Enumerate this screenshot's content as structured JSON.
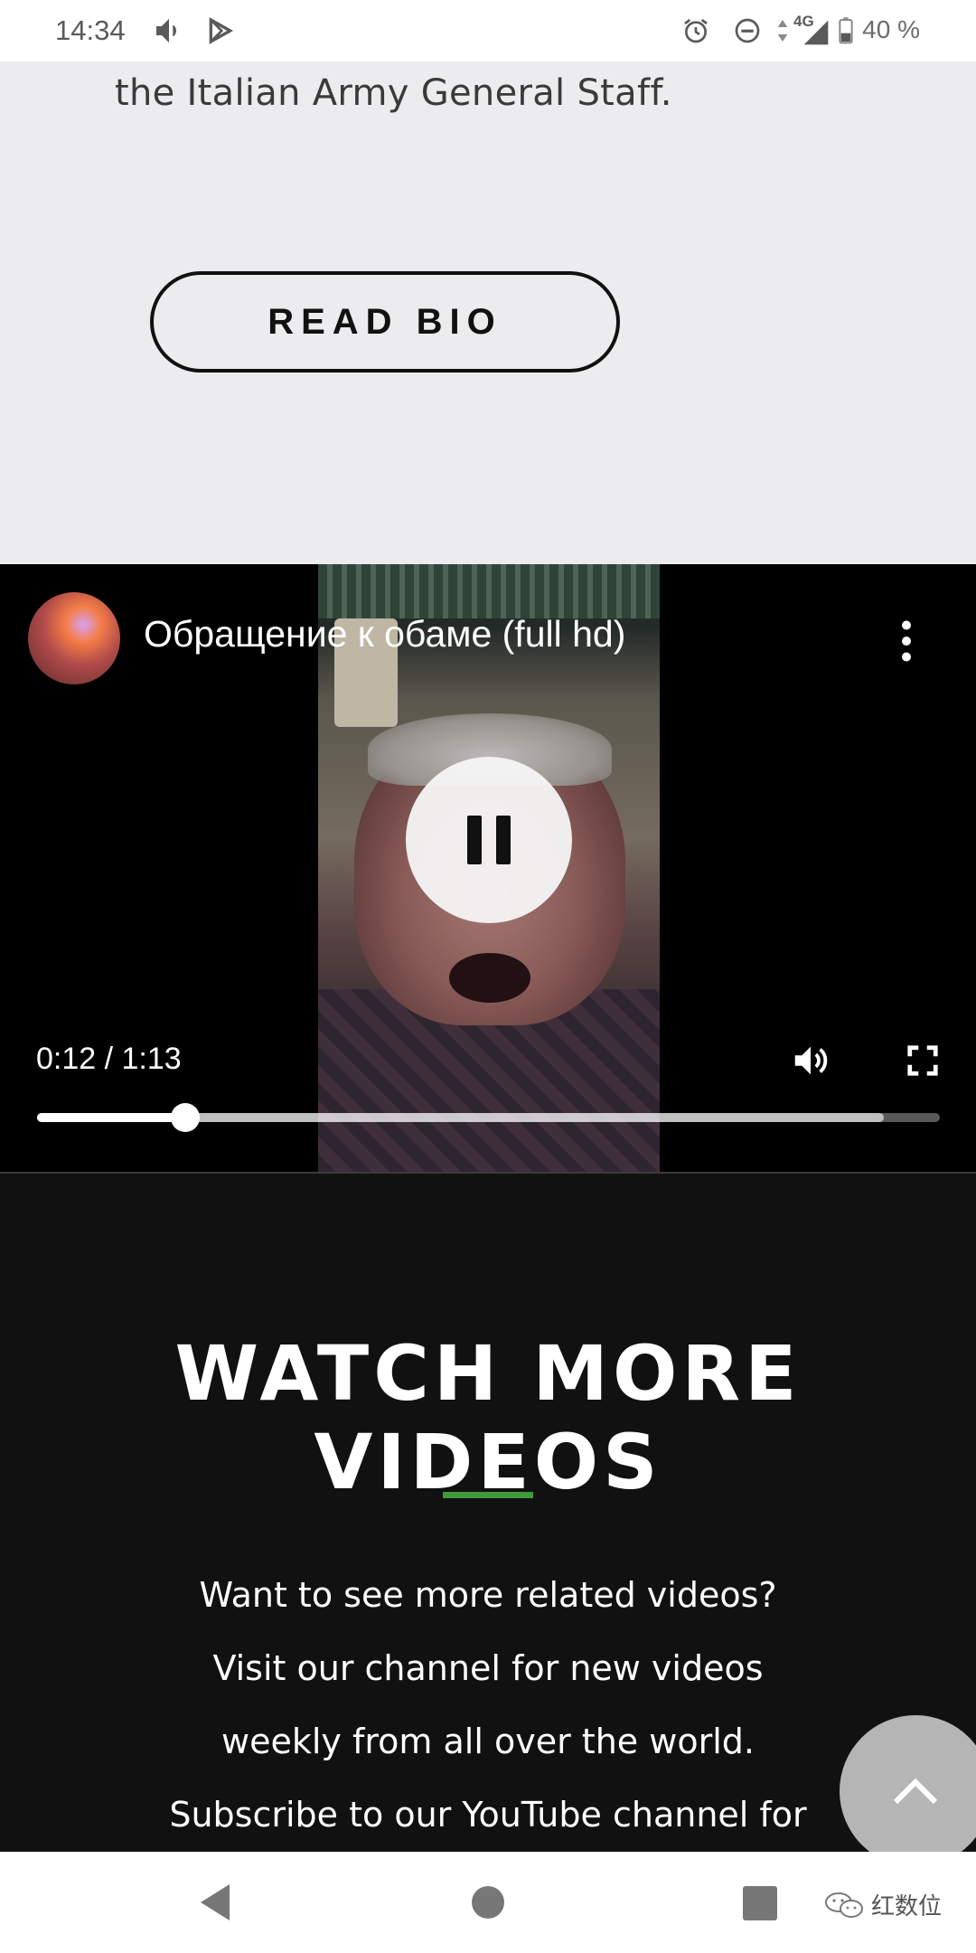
{
  "status_bar": {
    "time": "14:34",
    "network": "4G",
    "battery": "40 %"
  },
  "bio": {
    "text_tail": "the Italian Army General Staff.",
    "read_bio_label": "READ BIO"
  },
  "player": {
    "title": "Обращение к обаме (full hd)",
    "time": "0:12 / 1:13",
    "progress": 0.164,
    "buffered": 0.938
  },
  "watch_more": {
    "heading": "WATCH MORE VIDEOS",
    "lines": [
      "Want to see more related videos?",
      "Visit our channel for new videos",
      "weekly from all over the world.",
      "Subscribe to our YouTube channel for"
    ]
  },
  "watermark": {
    "text": "红数位"
  },
  "colors": {
    "accent_green": "#3f9a3a",
    "dark_bg": "#111111",
    "light_bg": "#ececee"
  }
}
